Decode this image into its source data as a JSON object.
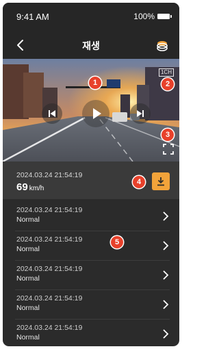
{
  "status_bar": {
    "time": "9:41 AM",
    "battery": "100%"
  },
  "header": {
    "title": "재생"
  },
  "player": {
    "channel_label": "1CH",
    "progress_fraction": 0.0
  },
  "selected": {
    "datetime": "2024.03.24 21:54:19",
    "speed_value": "69",
    "speed_unit": "km/h"
  },
  "records": [
    {
      "datetime": "2024.03.24 21:54:19",
      "status": "Normal"
    },
    {
      "datetime": "2024.03.24 21:54:19",
      "status": "Normal"
    },
    {
      "datetime": "2024.03.24 21:54:19",
      "status": "Normal"
    },
    {
      "datetime": "2024.03.24 21:54:19",
      "status": "Normal"
    },
    {
      "datetime": "2024.03.24 21:54:19",
      "status": "Normal"
    }
  ],
  "markers": [
    "1",
    "2",
    "3",
    "4",
    "5"
  ],
  "colors": {
    "accent": "#f2a33a",
    "marker": "#e8412b",
    "background": "#2b2b2b"
  },
  "icons": {
    "back": "chevron-left-icon",
    "layers": "layers-icon",
    "prev": "skip-previous-icon",
    "play": "play-icon",
    "next": "skip-next-icon",
    "fullscreen": "fullscreen-icon",
    "download": "download-icon",
    "row_chevron": "chevron-right-icon"
  }
}
